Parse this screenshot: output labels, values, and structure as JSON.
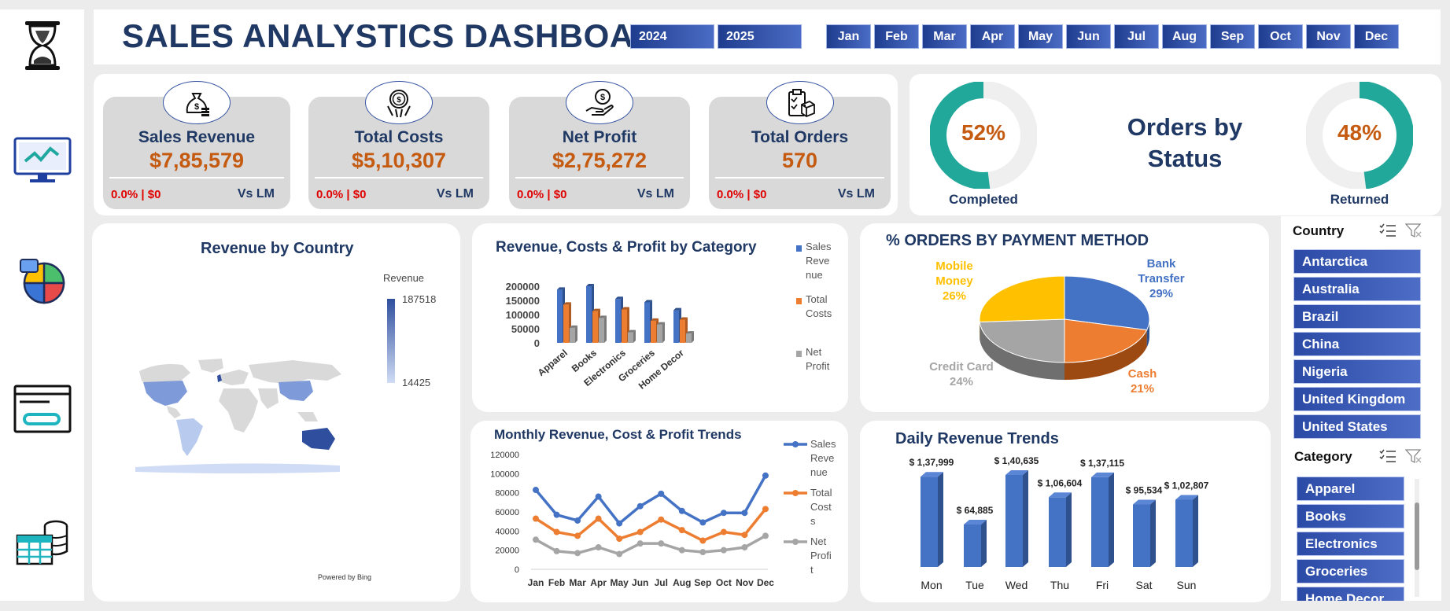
{
  "header": {
    "title": "SALES ANALYSTICS DASHBOARD",
    "years": [
      "2024",
      "2025"
    ],
    "months": [
      "Jan",
      "Feb",
      "Mar",
      "Apr",
      "May",
      "Jun",
      "Jul",
      "Aug",
      "Sep",
      "Oct",
      "Nov",
      "Dec"
    ]
  },
  "sidebar": {
    "icons": [
      "hourglass-icon",
      "monitor-chart-icon",
      "pie-chart-icon",
      "browser-window-icon",
      "database-table-icon"
    ]
  },
  "kpis": [
    {
      "label": "Sales Revenue",
      "value": "$7,85,579",
      "change": "0.0% | $0",
      "compare": "Vs LM",
      "icon": "money-bag-icon"
    },
    {
      "label": "Total Costs",
      "value": "$5,10,307",
      "change": "0.0% | $0",
      "compare": "Vs LM",
      "icon": "coin-hand-icon"
    },
    {
      "label": "Net Profit",
      "value": "$2,75,272",
      "change": "0.0% | $0",
      "compare": "Vs LM",
      "icon": "dollar-hand-icon"
    },
    {
      "label": "Total Orders",
      "value": "570",
      "change": "0.0% | $0",
      "compare": "Vs LM",
      "icon": "clipboard-box-icon"
    }
  ],
  "orders_status": {
    "title_line1": "Orders by",
    "title_line2": "Status",
    "completed": {
      "pct_label": "52%",
      "label": "Completed",
      "fraction": 0.52
    },
    "returned": {
      "pct_label": "48%",
      "label": "Returned",
      "fraction": 0.48
    }
  },
  "map": {
    "title": "Revenue by Country",
    "legend_title": "Revenue",
    "legend_max": "187518",
    "legend_min": "14425",
    "credit": "Powered by Bing"
  },
  "colors": {
    "navy": "#1f3864",
    "accent": "#c55a11",
    "blue": "#4472c4",
    "orange": "#ed7d31",
    "gray": "#a5a5a5",
    "teal": "#21a89a",
    "yellow": "#ffc000"
  },
  "slicers": {
    "country_title": "Country",
    "countries": [
      "Antarctica",
      "Australia",
      "Brazil",
      "China",
      "Nigeria",
      "United Kingdom",
      "United States"
    ],
    "category_title": "Category",
    "categories": [
      "Apparel",
      "Books",
      "Electronics",
      "Groceries",
      "Home Decor"
    ]
  },
  "chart_data": [
    {
      "type": "bar",
      "title": "Revenue, Costs & Profit by Category",
      "categories": [
        "Apparel",
        "Books",
        "Electronics",
        "Groceries",
        "Home Decor"
      ],
      "series": [
        {
          "name": "Sales Revenue",
          "values": [
            188000,
            200000,
            155000,
            143000,
            115000
          ]
        },
        {
          "name": "Total Costs",
          "values": [
            135000,
            112000,
            118000,
            78000,
            82000
          ]
        },
        {
          "name": "Net Profit",
          "values": [
            53000,
            88000,
            37000,
            65000,
            33000
          ]
        }
      ],
      "yticks": [
        "200000",
        "150000",
        "100000",
        "50000",
        "0"
      ],
      "ylim": [
        0,
        200000
      ],
      "legend": "right"
    },
    {
      "type": "pie",
      "title": "% ORDERS BY PAYMENT METHOD",
      "slices": [
        {
          "name": "Bank Transfer",
          "value": 29,
          "label": "29%",
          "color": "#4472c4"
        },
        {
          "name": "Cash",
          "value": 21,
          "label": "21%",
          "color": "#ed7d31"
        },
        {
          "name": "Credit Card",
          "value": 24,
          "label": "24%",
          "color": "#a5a5a5"
        },
        {
          "name": "Mobile Money",
          "value": 26,
          "label": "26%",
          "color": "#ffc000"
        }
      ]
    },
    {
      "type": "line",
      "title": "Monthly Revenue, Cost & Profit Trends",
      "categories": [
        "Jan",
        "Feb",
        "Mar",
        "Apr",
        "May",
        "Jun",
        "Jul",
        "Aug",
        "Sep",
        "Oct",
        "Nov",
        "Dec"
      ],
      "series": [
        {
          "name": "Sales Revenue",
          "color": "#4472c4",
          "values": [
            83000,
            57000,
            51000,
            76000,
            48000,
            66000,
            79000,
            61000,
            49000,
            59000,
            59000,
            98000
          ]
        },
        {
          "name": "Total Costs",
          "color": "#ed7d31",
          "values": [
            53000,
            39000,
            35000,
            53000,
            32000,
            39000,
            52000,
            41000,
            30000,
            39000,
            36000,
            63000
          ]
        },
        {
          "name": "Net Profit",
          "color": "#a5a5a5",
          "values": [
            31000,
            19000,
            17000,
            23000,
            16000,
            27000,
            27000,
            20000,
            18000,
            20000,
            23000,
            35000
          ]
        }
      ],
      "yticks": [
        "120000",
        "100000",
        "80000",
        "60000",
        "40000",
        "20000",
        "0"
      ],
      "ylim": [
        0,
        120000
      ],
      "legend": "right"
    },
    {
      "type": "bar",
      "title": "Daily Revenue Trends",
      "categories": [
        "Mon",
        "Tue",
        "Wed",
        "Thu",
        "Fri",
        "Sat",
        "Sun"
      ],
      "values": [
        137999,
        64885,
        140635,
        106604,
        137115,
        95534,
        102807
      ],
      "labels": [
        "$ 1,37,999",
        "$ 64,885",
        "$ 1,40,635",
        "$ 1,06,604",
        "$ 1,37,115",
        "$ 95,534",
        "$ 1,02,807"
      ],
      "ylim": [
        0,
        150000
      ]
    }
  ]
}
